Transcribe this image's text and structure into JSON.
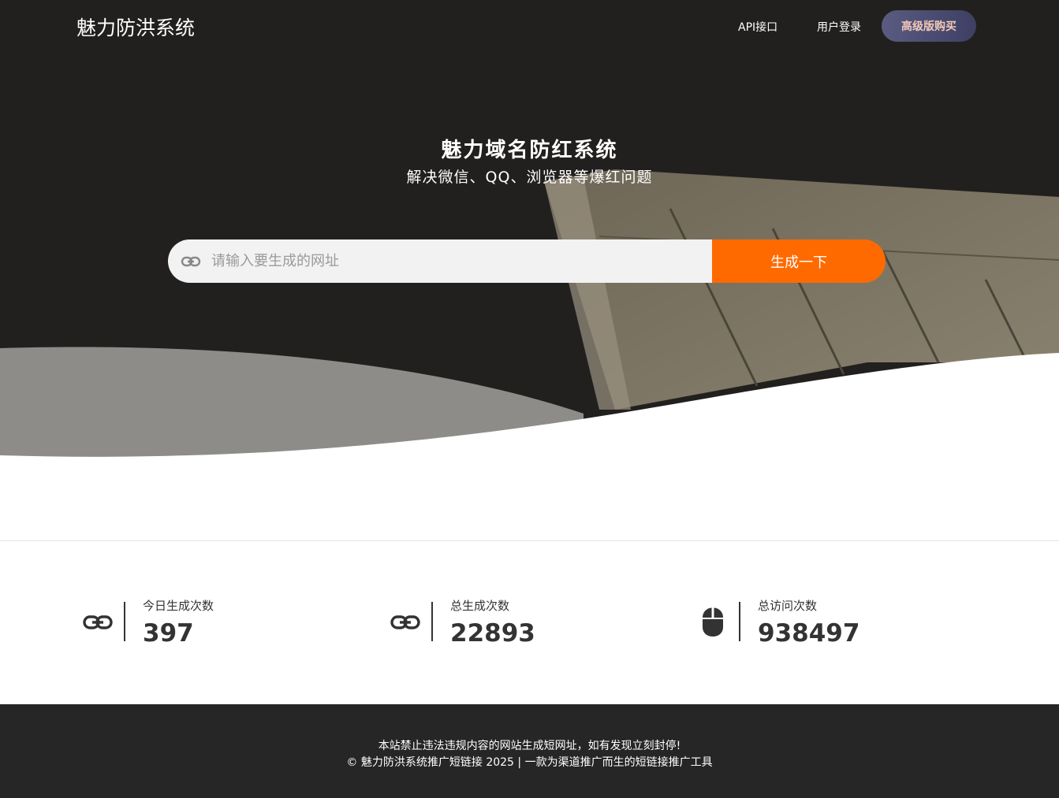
{
  "nav": {
    "brand": "魅力防洪系统",
    "links": [
      "API接口",
      "用户登录"
    ],
    "buy_label": "高级版购买"
  },
  "hero": {
    "title": "魅力域名防红系统",
    "subtitle": "解决微信、QQ、浏览器等爆红问题",
    "search": {
      "placeholder": "请输入要生成的网址",
      "value": "",
      "button_label": "生成一下"
    }
  },
  "stats": [
    {
      "label": "今日生成次数",
      "value": "397",
      "icon": "link-icon"
    },
    {
      "label": "总生成次数",
      "value": "22893",
      "icon": "link-icon"
    },
    {
      "label": "总访问次数",
      "value": "938497",
      "icon": "mouse-icon"
    }
  ],
  "footer": {
    "line1": "本站禁止违法违规内容的网站生成短网址，如有发现立刻封停!",
    "line2": "© 魅力防洪系统推广短链接 2025 | 一款为渠道推广而生的短链接推广工具"
  },
  "colors": {
    "hero_bg": "#22201e",
    "accent_orange": "#ff6a00",
    "buy_button": "#4a4b70",
    "footer_bg": "#262626"
  }
}
